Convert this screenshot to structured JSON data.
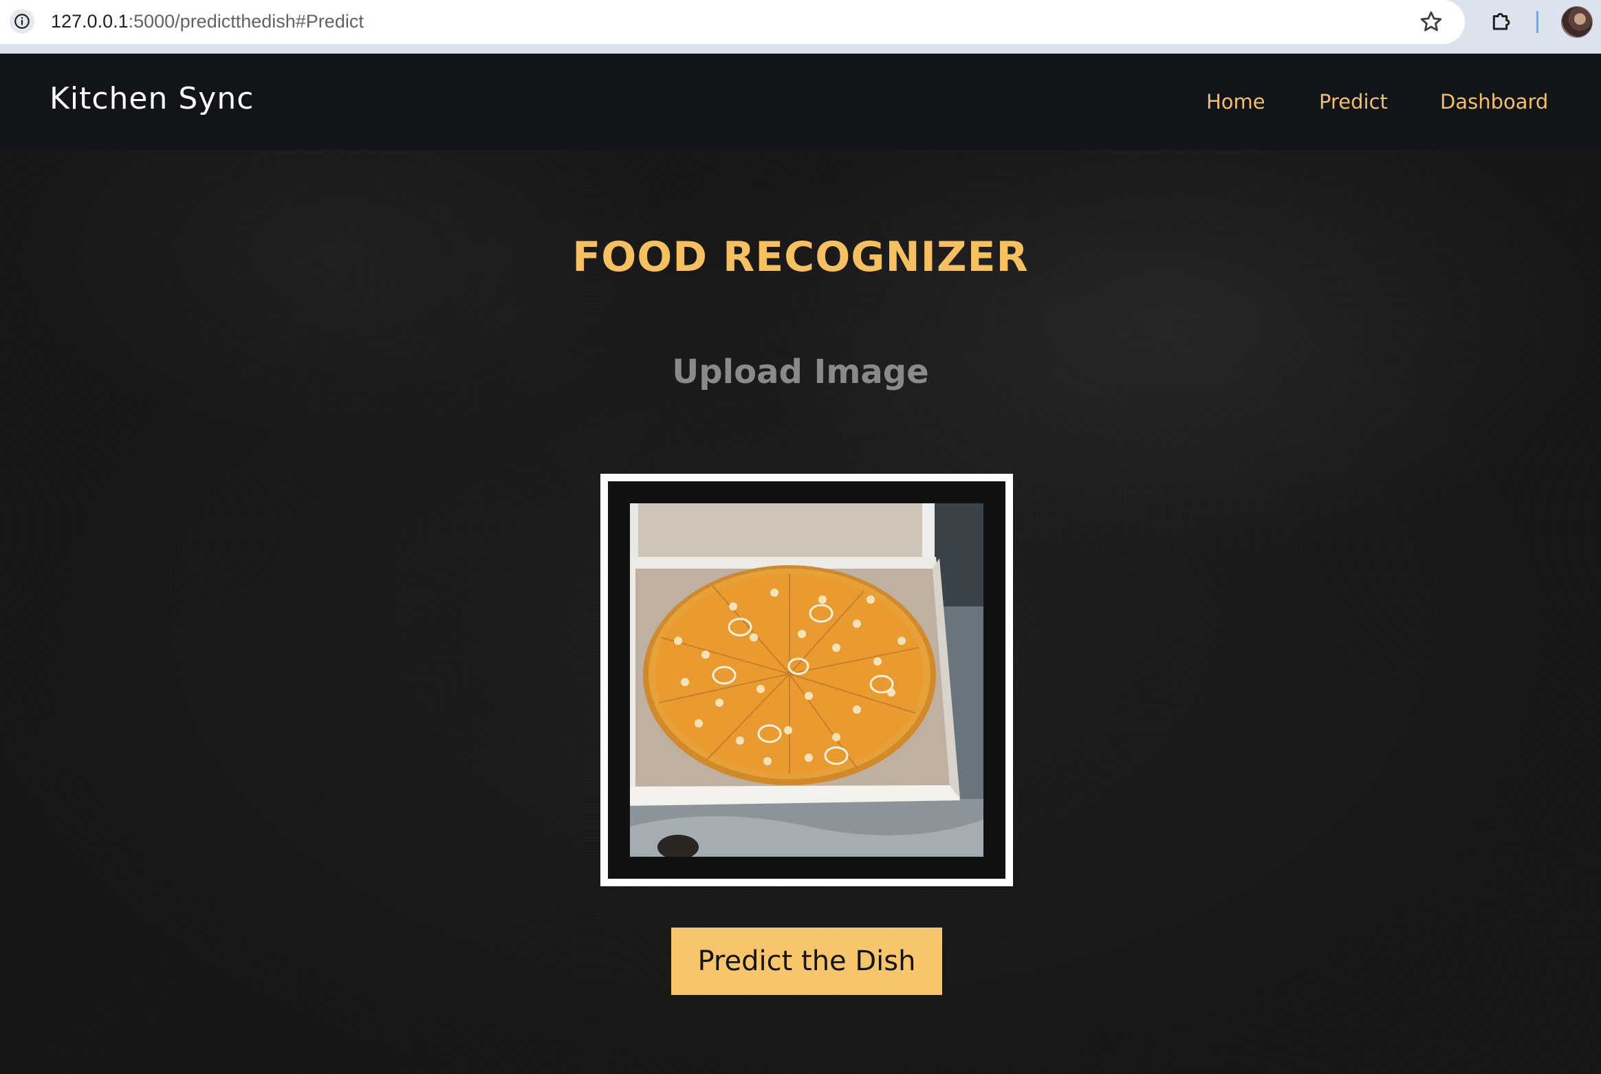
{
  "browser": {
    "url_host": "127.0.0.1",
    "url_path": ":5000/predictthedish#Predict",
    "icons": {
      "site_info": "info-circle-icon",
      "bookmark": "star-icon",
      "extensions": "puzzle-icon",
      "profile": "avatar"
    }
  },
  "navbar": {
    "brand": "Kitchen Sync",
    "links": [
      {
        "label": "Home"
      },
      {
        "label": "Predict"
      },
      {
        "label": "Dashboard"
      }
    ]
  },
  "main": {
    "title": "FOOD RECOGNIZER",
    "upload_heading": "Upload Image",
    "preview_image": "pizza photo in a cardboard box",
    "predict_button_label": "Predict the Dish"
  },
  "colors": {
    "accent": "#f7c05e",
    "button_bg": "#f8c66a",
    "navbar_bg": "#111418",
    "page_bg": "#1d1d1d",
    "heading_gray": "#8a8a8a"
  }
}
